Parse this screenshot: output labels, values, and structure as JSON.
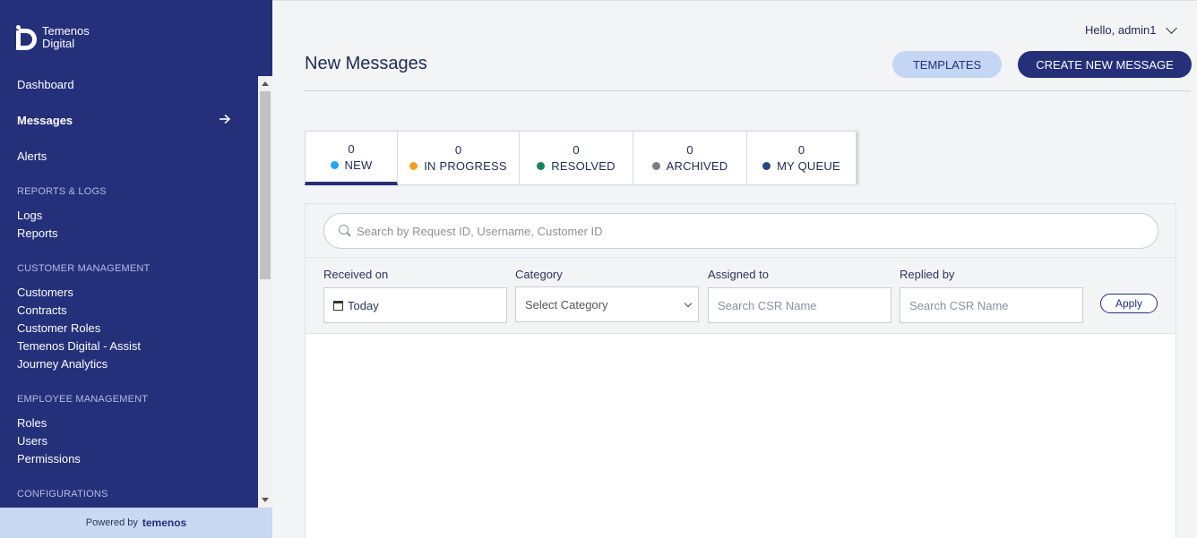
{
  "logo": {
    "line1": "Temenos",
    "line2": "Digital"
  },
  "sidebar": {
    "items": [
      {
        "label": "Dashboard"
      },
      {
        "label": "Messages"
      },
      {
        "label": "Alerts"
      }
    ],
    "sections": [
      {
        "title": "REPORTS & LOGS",
        "items": [
          "Logs",
          "Reports"
        ]
      },
      {
        "title": "CUSTOMER MANAGEMENT",
        "items": [
          "Customers",
          "Contracts",
          "Customer Roles",
          "Temenos Digital - Assist",
          "Journey Analytics"
        ]
      },
      {
        "title": "EMPLOYEE MANAGEMENT",
        "items": [
          "Roles",
          "Users",
          "Permissions"
        ]
      },
      {
        "title": "CONFIGURATIONS",
        "items": []
      }
    ],
    "powered_by": "Powered by",
    "brand": "temenos"
  },
  "header": {
    "greeting": "Hello, admin1",
    "title": "New Messages",
    "templates_label": "TEMPLATES",
    "create_label": "CREATE NEW MESSAGE"
  },
  "tabs": [
    {
      "count": "0",
      "label": "NEW",
      "color": "#1ea7f0"
    },
    {
      "count": "0",
      "label": "IN PROGRESS",
      "color": "#f5a01a"
    },
    {
      "count": "0",
      "label": "RESOLVED",
      "color": "#12875a"
    },
    {
      "count": "0",
      "label": "ARCHIVED",
      "color": "#7d7d7d"
    },
    {
      "count": "0",
      "label": "MY QUEUE",
      "color": "#24487a"
    }
  ],
  "search": {
    "placeholder": "Search by Request ID, Username, Customer ID"
  },
  "filters": {
    "received_label": "Received on",
    "received_value": "Today",
    "category_label": "Category",
    "category_value": "Select Category",
    "assigned_label": "Assigned to",
    "assigned_placeholder": "Search CSR Name",
    "replied_label": "Replied by",
    "replied_placeholder": "Search CSR Name",
    "apply_label": "Apply"
  }
}
